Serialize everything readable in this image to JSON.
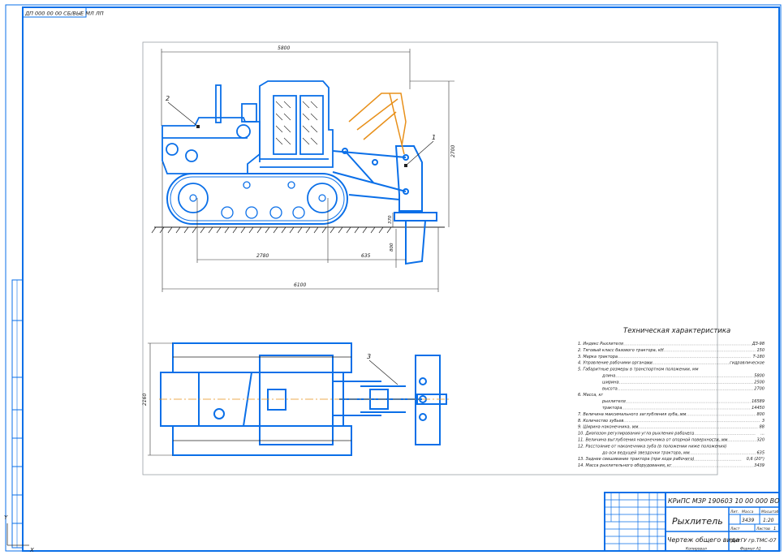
{
  "sheet": {
    "corner_code": "ДП 000 00 00 СБ/ВЫЕ МЛ ЛП",
    "dims": {
      "top_length": "5800",
      "height": "2700",
      "ground_gap": "370",
      "depth": "800",
      "track_base": "2780",
      "ripper_offset": "635",
      "total_length": "6100",
      "plan_width": "2160"
    },
    "callouts": [
      "1",
      "2",
      "3"
    ]
  },
  "tech": {
    "title": "Техническая характеристика",
    "rows": [
      {
        "text": "1. Индекс Рыхлителя",
        "value": "ДЗ-98"
      },
      {
        "text": "2. Тяговый класс базового трактора, кН",
        "value": "150"
      },
      {
        "text": "3. Марка трактора",
        "value": "Т-180"
      },
      {
        "text": "4. Управление рабочими органами",
        "value": "гидравлическое"
      },
      {
        "text": "5. Габаритные размеры в транспортном положении, мм",
        "value": ""
      },
      {
        "text": "длина",
        "value": "5800"
      },
      {
        "text": "ширина",
        "value": "2500"
      },
      {
        "text": "высота",
        "value": "2700"
      },
      {
        "text": "6. Масса, кг",
        "value": ""
      },
      {
        "text": "рыхлителя",
        "value": "16589"
      },
      {
        "text": "трактора",
        "value": "14450"
      },
      {
        "text": "7. Величина максимального заглубления зуба, мм",
        "value": "800"
      },
      {
        "text": "8. Количество зубьев",
        "value": "3"
      },
      {
        "text": "9. Ширина наконечника, мм",
        "value": "88"
      },
      {
        "text": "10. Диапазон регулирования угла рыхления рабочего",
        "value": "..."
      },
      {
        "text": "11. Величина выглубления наконечника от опорной поверхности, мм",
        "value": "320"
      },
      {
        "text": "12. Расстояние от наконечника зуба (в положении ниже положения)",
        "value": ""
      },
      {
        "text": "до оси ведущей звездочки трактора, мм",
        "value": "635"
      },
      {
        "text": "13. Заднее свешивание трактора (при ходе рабочего)",
        "value": "0,6 (20°)"
      },
      {
        "text": "14. Масса рыхлительного оборудования, кг",
        "value": "3439"
      }
    ]
  },
  "stamp": {
    "doc_code": "КРиПС МЗР 190603 10 00 000 ВО",
    "title": "Рыхлитель",
    "subtitle": "Чертеж общего вида",
    "org": "ЧитГУ гр.ТМС-07",
    "litera_label": "Лит.",
    "mass_label": "Масса",
    "scale_label": "Масштаб",
    "mass_value": "3439",
    "scale_value": "1:20",
    "sheet_label": "Лист",
    "sheets_label": "Листов",
    "sheets_value": "1",
    "format_label": "Формат А1",
    "copy_label": "Копировал"
  },
  "axes": {
    "y": "Y",
    "x": "X"
  }
}
